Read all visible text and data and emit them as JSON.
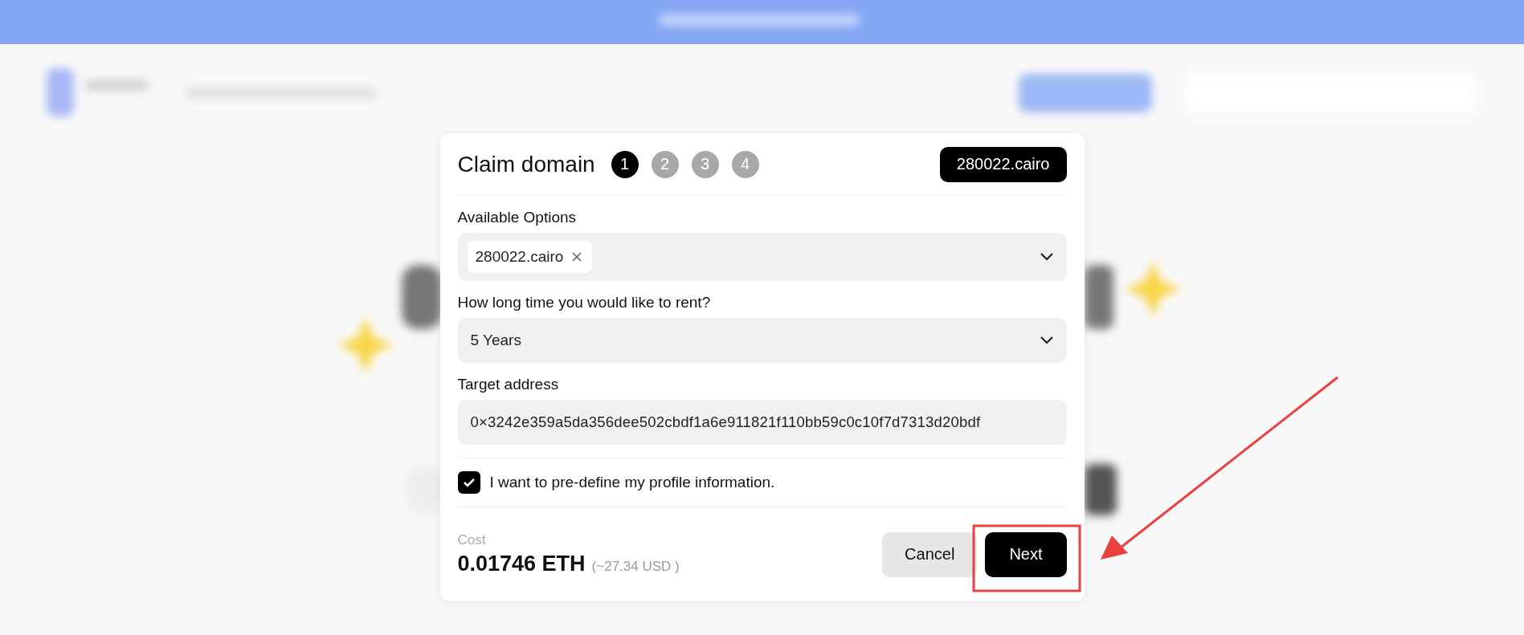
{
  "dialog": {
    "title": "Claim domain",
    "steps": [
      {
        "label": "1",
        "selected": true
      },
      {
        "label": "2",
        "selected": false
      },
      {
        "label": "3",
        "selected": false
      },
      {
        "label": "4",
        "selected": false
      }
    ],
    "domain_badge": "280022.cairo",
    "fields": [
      {
        "kind": "tags",
        "label": "Available Options",
        "tags": [
          "280022.cairo"
        ]
      },
      {
        "kind": "select",
        "label": "How long time you would like to rent?",
        "value": "5 Years"
      },
      {
        "kind": "text",
        "label": "Target address",
        "value": "0×3242e359a5da356dee502cbdf1a6e911821f110bb59c0c10f7d7313d20bdf"
      }
    ],
    "checkbox": {
      "label": "I want to pre-define my profile information.",
      "checked": true
    },
    "cost": {
      "label": "Cost",
      "amount": "0.01746 ETH",
      "usd": "(~27.34 USD )"
    },
    "buttons": [
      {
        "kind": "secondary",
        "label": "Cancel"
      },
      {
        "kind": "primary",
        "label": "Next"
      }
    ]
  }
}
